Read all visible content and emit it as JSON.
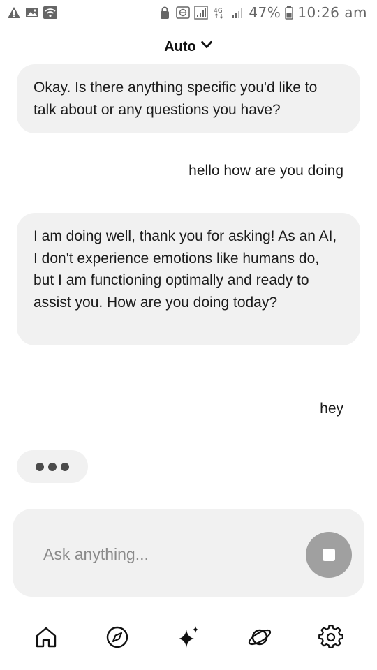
{
  "status_bar": {
    "left_icons": [
      "warning-icon",
      "image-icon",
      "wifi-icon"
    ],
    "right_icons": [
      "lock-icon",
      "globe-icon",
      "signal-icon",
      "network-4g-icon",
      "signal-weak-icon",
      "battery-icon"
    ],
    "battery_percent": "47%",
    "time": "10:26 am"
  },
  "header": {
    "model_label": "Auto"
  },
  "chat": {
    "messages": [
      {
        "role": "assistant",
        "text": "Okay. Is there anything specific you'd like to talk about or any questions you have?"
      },
      {
        "role": "user",
        "text": "hello how are you doing"
      },
      {
        "role": "assistant",
        "text": "I am doing well, thank you for asking! As an AI, I don't experience emotions like humans do, but I am functioning optimally and ready to assist you. How are you doing today?"
      },
      {
        "role": "user",
        "text": "hey"
      }
    ],
    "typing_indicator": true
  },
  "composer": {
    "placeholder": "Ask anything...",
    "value": "",
    "action_icon": "stop-icon"
  },
  "bottom_nav": {
    "items": [
      {
        "icon": "home-icon"
      },
      {
        "icon": "compass-icon"
      },
      {
        "icon": "sparkle-icon",
        "active": true
      },
      {
        "icon": "planet-icon"
      },
      {
        "icon": "settings-gear-icon"
      }
    ]
  },
  "colors": {
    "bubble_bg": "#f1f1f1",
    "stop_button_bg": "#a0a0a0",
    "text": "#1b1b1b"
  }
}
